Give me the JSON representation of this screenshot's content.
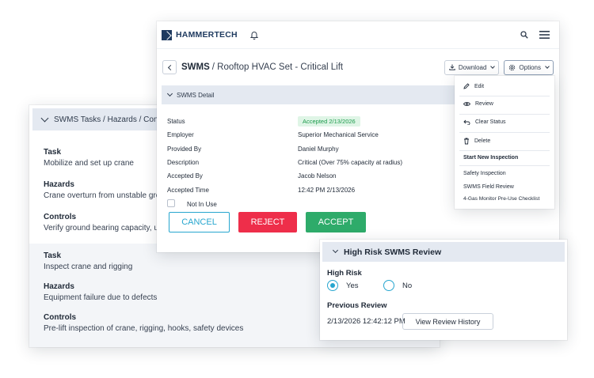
{
  "tasks_panel": {
    "header": "SWMS Tasks / Hazards / Controls",
    "groups": [
      {
        "label": "Task",
        "value": "Mobilize and set up crane"
      },
      {
        "label": "Hazards",
        "value": "Crane overturn from unstable gro"
      },
      {
        "label": "Controls",
        "value": "Verify ground bearing capacity, us"
      },
      {
        "label": "Task",
        "value": "Inspect crane and rigging"
      },
      {
        "label": "Hazards",
        "value": "Equipment failure due to defects"
      },
      {
        "label": "Controls",
        "value": "Pre-lift inspection of crane, rigging, hooks, safety devices"
      }
    ]
  },
  "app": {
    "brand": "HAMMERTECH",
    "icons": {
      "bell": "bell-icon",
      "search": "search-icon",
      "menu": "hamburger-menu-icon"
    }
  },
  "page": {
    "title_prefix": "SWMS",
    "title_rest": "/ Rooftop HVAC Set - Critical Lift",
    "download_label": "Download",
    "options_label": "Options"
  },
  "detail": {
    "header": "SWMS Detail",
    "rows": [
      {
        "label": "Status",
        "value": "Accepted 2/13/2026"
      },
      {
        "label": "Employer",
        "value": "Superior Mechanical Service"
      },
      {
        "label": "Provided By",
        "value": "Daniel Murphy"
      },
      {
        "label": "Description",
        "value": "Critical (Over 75% capacity at radius)"
      },
      {
        "label": "Accepted By",
        "value": "Jacob Nelson"
      },
      {
        "label": "Accepted Time",
        "value": "12:42 PM 2/13/2026"
      }
    ],
    "not_in_use_label": "Not In Use",
    "cancel_label": "CANCEL",
    "reject_label": "REJECT",
    "accept_label": "ACCEPT"
  },
  "options_menu": {
    "items": [
      {
        "label": "Edit",
        "icon": "pencil-icon"
      },
      {
        "label": "Review",
        "icon": "eye-icon"
      },
      {
        "label": "Clear Status",
        "icon": "undo-icon"
      },
      {
        "label": "Delete",
        "icon": "trash-icon"
      }
    ],
    "section_title": "Start New Inspection",
    "inspections": [
      "Safety Inspection",
      "SWMS Field Review",
      "4-Gas Monitor Pre-Use Checklist"
    ]
  },
  "review": {
    "header": "High Risk SWMS Review",
    "high_risk_label": "High Risk",
    "yes_label": "Yes",
    "no_label": "No",
    "selected": "Yes",
    "previous_review_label": "Previous Review",
    "previous_review_value": "2/13/2026 12:42:12 PM",
    "history_button": "View Review History"
  },
  "colors": {
    "accent": "#27a6cf",
    "reject": "#ee2e4a",
    "accept": "#2eab6a",
    "brand": "#1e3a5f",
    "status_badge": "#1c9a4c"
  }
}
